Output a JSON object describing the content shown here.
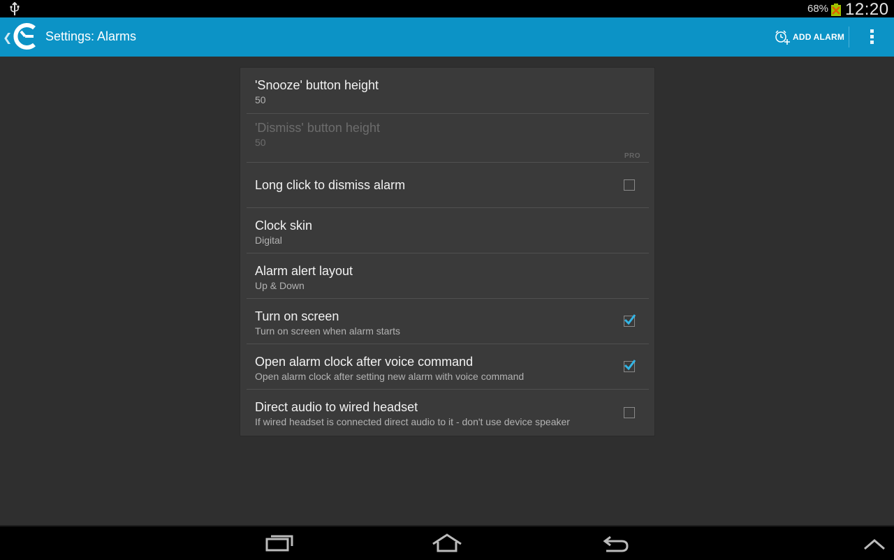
{
  "status_bar": {
    "battery_percent": "68%",
    "time": "12:20",
    "icons": [
      "usb-icon",
      "battery-icon"
    ]
  },
  "action_bar": {
    "title": "Settings: Alarms",
    "add_alarm_label": "ADD ALARM",
    "icons": [
      "up-caret-icon",
      "app-logo-icon",
      "add-alarm-icon",
      "overflow-menu-icon"
    ]
  },
  "settings": {
    "snooze_height": {
      "title": "'Snooze' button height",
      "value": "50"
    },
    "dismiss_height": {
      "title": "'Dismiss' button height",
      "value": "50",
      "badge": "PRO"
    },
    "long_click": {
      "title": "Long click to dismiss alarm",
      "checked": false
    },
    "clock_skin": {
      "title": "Clock skin",
      "value": "Digital"
    },
    "alert_layout": {
      "title": "Alarm alert layout",
      "value": "Up & Down"
    },
    "turn_on_screen": {
      "title": "Turn on screen",
      "summary": "Turn on screen when alarm starts",
      "checked": true
    },
    "voice_command": {
      "title": "Open alarm clock after voice command",
      "summary": "Open alarm clock after setting new alarm with voice command",
      "checked": true
    },
    "wired_headset": {
      "title": "Direct audio to wired headset",
      "summary": "If wired headset is connected direct audio to it - don't use device speaker",
      "checked": false
    }
  },
  "nav_bar": {
    "icons": [
      "recent-apps-icon",
      "home-icon",
      "back-icon",
      "chevron-up-icon"
    ]
  },
  "colors": {
    "action_bar": "#0c93c6",
    "background": "#2f2f2f",
    "card": "#3a3a3a",
    "checkmark": "#33b5e5"
  }
}
